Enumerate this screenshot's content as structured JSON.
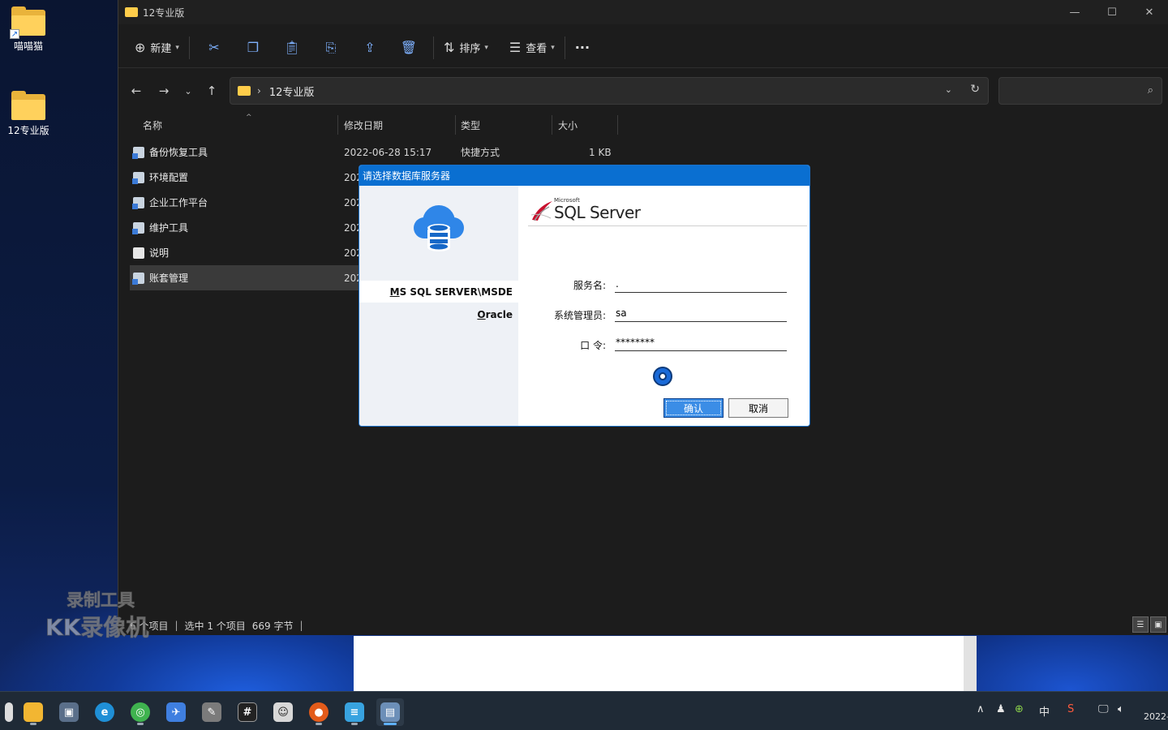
{
  "desktop": {
    "icons": [
      {
        "label": "喵喵猫"
      },
      {
        "label": "12专业版"
      }
    ]
  },
  "explorer": {
    "title": "12专业版",
    "toolbar": {
      "new_label": "新建",
      "sort_label": "排序",
      "view_label": "查看",
      "more_label": "···"
    },
    "address": {
      "crumb": "12专业版"
    },
    "columns": [
      "名称",
      "修改日期",
      "类型",
      "大小"
    ],
    "files": [
      {
        "name": "备份恢复工具",
        "date": "2022-06-28 15:17",
        "type": "快捷方式",
        "size": "1 KB"
      },
      {
        "name": "环境配置",
        "date": "202",
        "type": "",
        "size": ""
      },
      {
        "name": "企业工作平台",
        "date": "202",
        "type": "",
        "size": ""
      },
      {
        "name": "维护工具",
        "date": "202",
        "type": "",
        "size": ""
      },
      {
        "name": "说明",
        "date": "202",
        "type": "",
        "size": ""
      },
      {
        "name": "账套管理",
        "date": "202",
        "type": "",
        "size": ""
      }
    ],
    "status": {
      "count": "6 个项目",
      "selected": "选中 1 个项目",
      "bytes": "669 字节"
    }
  },
  "dialog": {
    "title": "请选择数据库服务器",
    "tabs": [
      "MS SQL SERVER\\MSDE",
      "Oracle"
    ],
    "logo": {
      "small": "Microsoft",
      "big": "SQL Server"
    },
    "fields": {
      "server_label": "服务名:",
      "server_value": ".",
      "admin_label": "系统管理员:",
      "admin_value": "sa",
      "password_label": "口 令:",
      "password_value": "********"
    },
    "ok_label": "确认",
    "cancel_label": "取消"
  },
  "watermark": {
    "line1": "录制工具",
    "line2": "KK录像机"
  },
  "taskbar": {
    "tray_ime": "中",
    "clock": "2022-"
  }
}
